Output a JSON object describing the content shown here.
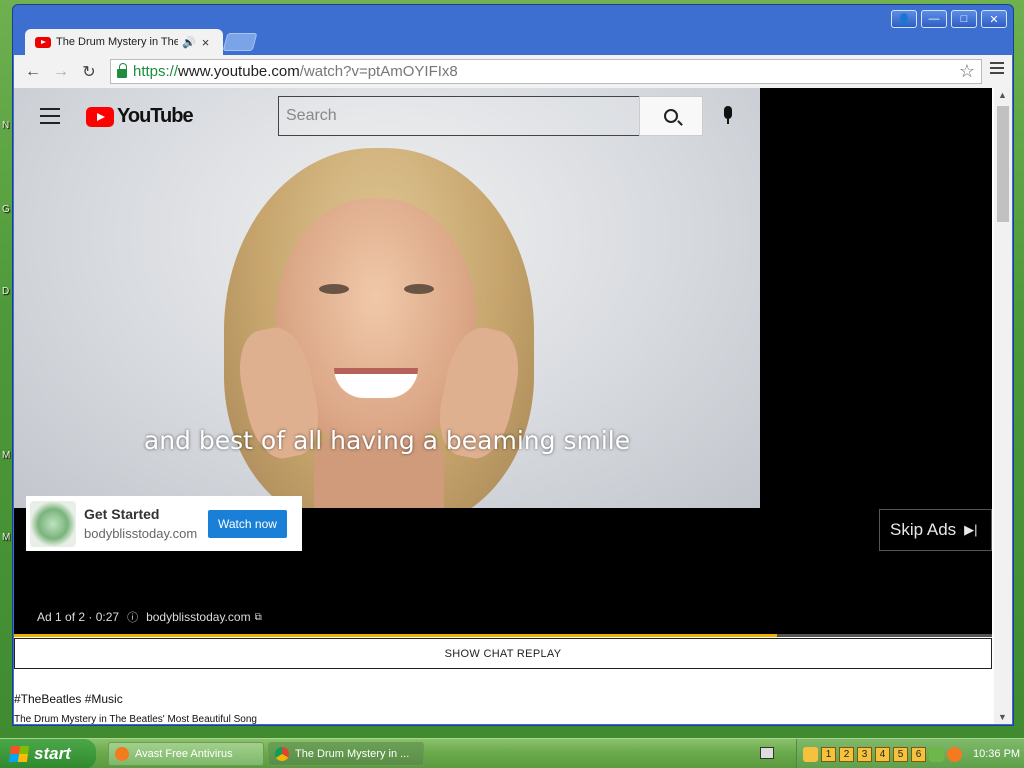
{
  "window": {
    "tab_title": "The Drum Mystery in The",
    "audio_glyph": "🔊",
    "close_glyph": "×",
    "controls": {
      "user": "👤",
      "minimize": "—",
      "maximize": "□",
      "close": "✕"
    }
  },
  "toolbar": {
    "back": "←",
    "forward": "→",
    "reload": "↻",
    "url_scheme": "https://",
    "url_host": "www.youtube.com",
    "url_path": "/watch?v=ptAmOYIFIx8",
    "star": "☆"
  },
  "youtube": {
    "logo_text": "YouTube",
    "search_placeholder": "Search",
    "caption": "and best of all having a beaming smile",
    "ad": {
      "title": "Get Started",
      "domain": "bodyblisstoday.com",
      "button": "Watch now"
    },
    "skip": {
      "label": "Skip Ads",
      "glyph": "▶|"
    },
    "ad_info": {
      "counter": "Ad 1 of 2 · 0:27",
      "info_glyph": "ⓘ",
      "domain": "bodyblisstoday.com",
      "ext_glyph": "⧉"
    },
    "progress_fraction": 0.78,
    "chat_replay": "SHOW CHAT REPLAY",
    "hashtags": "#TheBeatles #Music",
    "video_title": "The Drum Mystery in The Beatles' Most Beautiful Song"
  },
  "taskbar": {
    "start": "start",
    "tasks": [
      {
        "label": "Avast Free Antivirus"
      },
      {
        "label": "The Drum Mystery in ..."
      }
    ],
    "tray_numbers": [
      "1",
      "2",
      "3",
      "4",
      "5",
      "6"
    ],
    "clock": "10:36 PM"
  },
  "colors": {
    "accent_red": "#ff0000",
    "ad_button": "#1a7fd6",
    "progress": "#f4b000",
    "url_green": "#1e8e3e"
  }
}
